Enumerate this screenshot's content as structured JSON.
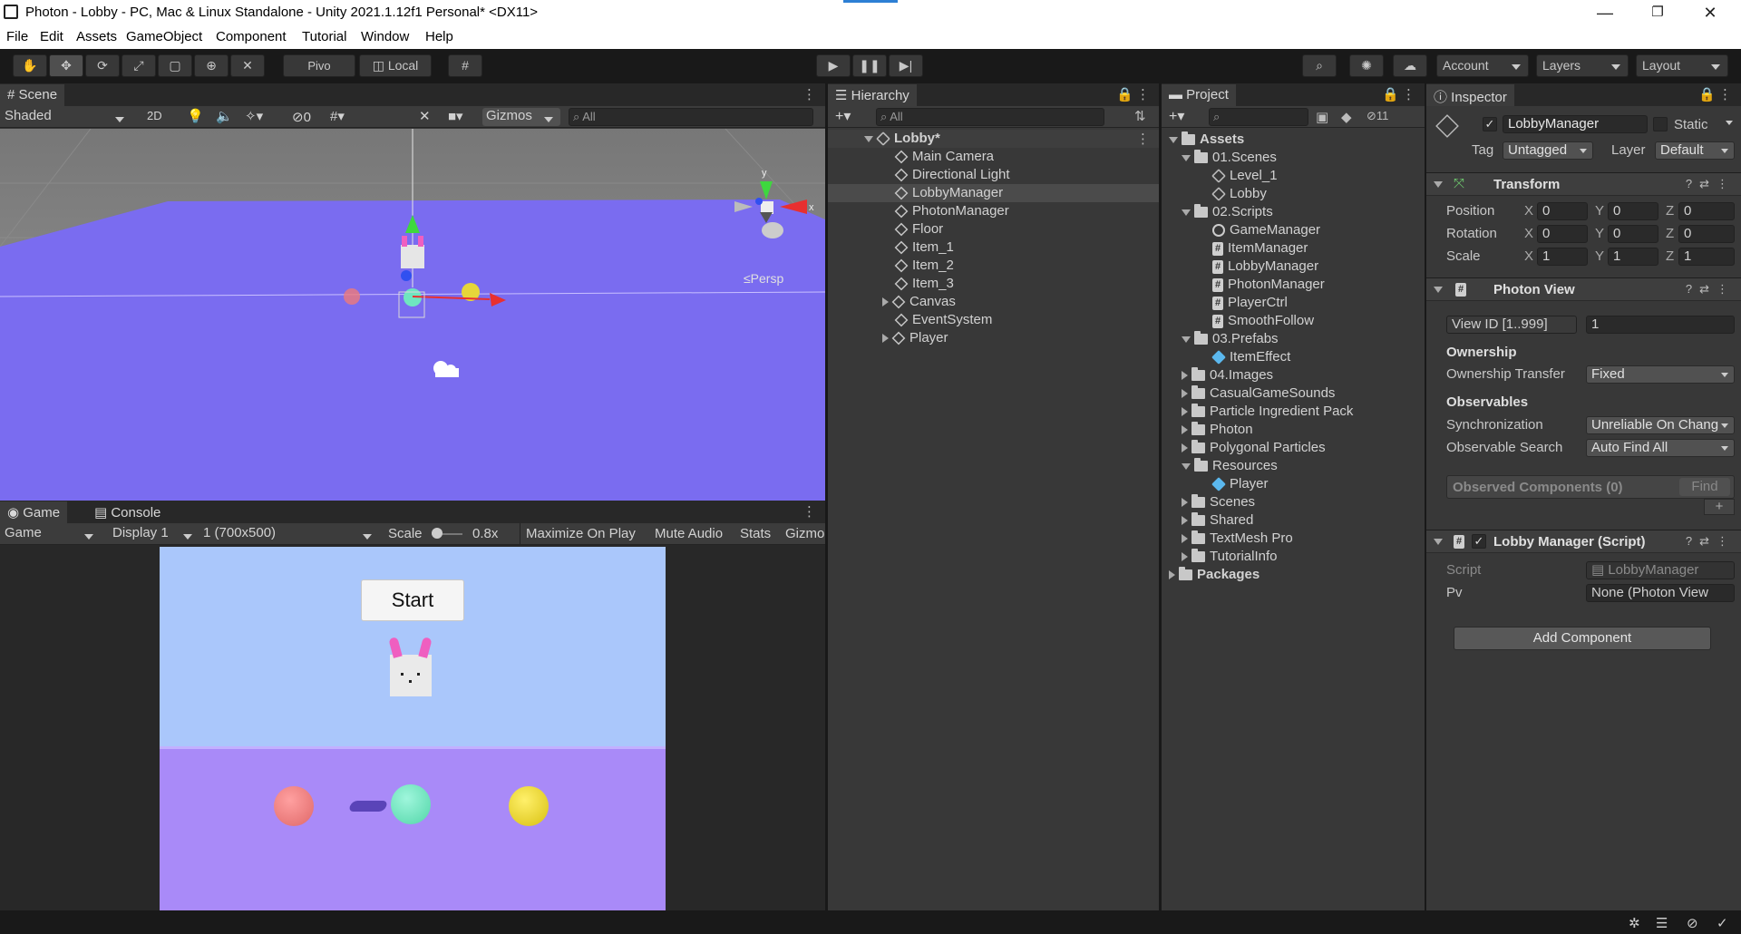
{
  "window": {
    "title": "Photon - Lobby - PC, Mac & Linux Standalone - Unity 2021.1.12f1 Personal* <DX11>",
    "minimize": "—",
    "restore": "❐",
    "close": "✕"
  },
  "menu": [
    "File",
    "Edit",
    "Assets",
    "GameObject",
    "Component",
    "Tutorial",
    "Window",
    "Help"
  ],
  "toolbar": {
    "pivot_label": "Pivo",
    "local_label": "Local",
    "account_label": "Account",
    "layers_label": "Layers",
    "layout_label": "Layout"
  },
  "scene": {
    "tab_label": "Scene",
    "shading_mode": "Shaded",
    "mode_2d": "2D",
    "hidden_count": "0",
    "gizmos_label": "Gizmos",
    "search_placeholder": "All",
    "persp_label": "≤Persp",
    "axis_y": "y",
    "axis_x": "x"
  },
  "game": {
    "tab_label": "Game",
    "console_tab_label": "Console",
    "view_mode": "Game",
    "display": "Display 1",
    "resolution": "1 (700x500)",
    "scale_label": "Scale",
    "scale_value": "0.8x",
    "maximize_label": "Maximize On Play",
    "mute_label": "Mute Audio",
    "stats_label": "Stats",
    "gizmos_label": "Gizmo",
    "start_button": "Start"
  },
  "hierarchy": {
    "tab_label": "Hierarchy",
    "search_placeholder": "All",
    "root": "Lobby*",
    "items": [
      "Main Camera",
      "Directional Light",
      "LobbyManager",
      "PhotonManager",
      "Floor",
      "Item_1",
      "Item_2",
      "Item_3",
      "Canvas",
      "EventSystem",
      "Player"
    ]
  },
  "project": {
    "tab_label": "Project",
    "hidden_count": "11",
    "assets_label": "Assets",
    "scenes_folder": "01.Scenes",
    "scene_files": [
      "Level_1",
      "Lobby"
    ],
    "scripts_folder": "02.Scripts",
    "script_files": [
      "GameManager",
      "ItemManager",
      "LobbyManager",
      "PhotonManager",
      "PlayerCtrl",
      "SmoothFollow"
    ],
    "prefabs_folder": "03.Prefabs",
    "prefab_files": [
      "ItemEffect"
    ],
    "other_folders_1": [
      "04.Images",
      "CasualGameSounds",
      "Particle Ingredient Pack",
      "Photon",
      "Polygonal Particles"
    ],
    "resources_folder": "Resources",
    "resource_files": [
      "Player"
    ],
    "other_folders_2": [
      "Scenes",
      "Shared",
      "TextMesh Pro",
      "TutorialInfo"
    ],
    "packages_label": "Packages"
  },
  "inspector": {
    "tab_label": "Inspector",
    "object_name": "LobbyManager",
    "static_label": "Static",
    "tag_label": "Tag",
    "tag_value": "Untagged",
    "layer_label": "Layer",
    "layer_value": "Default",
    "transform": {
      "title": "Transform",
      "position_label": "Position",
      "rotation_label": "Rotation",
      "scale_label": "Scale",
      "position": [
        "0",
        "0",
        "0"
      ],
      "rotation": [
        "0",
        "0",
        "0"
      ],
      "scale": [
        "1",
        "1",
        "1"
      ]
    },
    "photon_view": {
      "title": "Photon View",
      "view_id_label": "View ID [1..999]",
      "view_id": "1",
      "ownership_header": "Ownership",
      "ownership_transfer_label": "Ownership Transfer",
      "ownership_transfer": "Fixed",
      "observables_header": "Observables",
      "synchronization_label": "Synchronization",
      "synchronization": "Unreliable On Chang",
      "observable_search_label": "Observable Search",
      "observable_search": "Auto Find All",
      "observed_components": "Observed Components (0)",
      "find_button": "Find",
      "add_button": "+"
    },
    "lobby_manager": {
      "title": "Lobby Manager (Script)",
      "script_label": "Script",
      "script_value": "LobbyManager",
      "pv_label": "Pv",
      "pv_value": "None (Photon View"
    },
    "add_component": "Add Component"
  },
  "colors": {
    "floor": "#7a6cf0",
    "sky": "#aac7fb",
    "game_floor": "#a98af8",
    "ball_red": "#ee7a7a",
    "ball_teal": "#6fe6c0",
    "ball_yellow": "#e6d63a"
  }
}
